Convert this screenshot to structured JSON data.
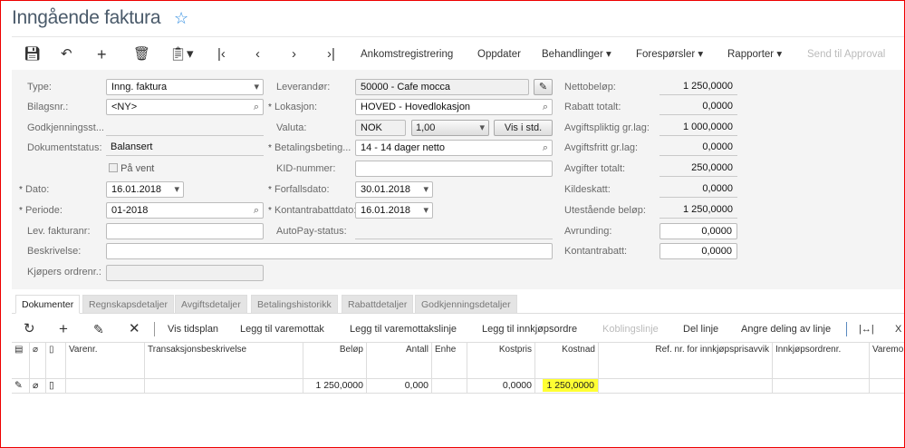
{
  "header": {
    "title": "Inngående faktura"
  },
  "toolbar": {
    "icons": [
      "save-icon",
      "undo-icon",
      "add-icon",
      "delete-icon",
      "clipboard-icon",
      "first-icon",
      "prev-icon",
      "next-icon",
      "last-icon"
    ],
    "ankomst": "Ankomstregistrering",
    "oppdater": "Oppdater",
    "behandlinger": "Behandlinger",
    "foresporsler": "Forespørsler",
    "rapporter": "Rapporter",
    "send": "Send til Approval"
  },
  "form": {
    "type_label": "Type:",
    "type_value": "Inng. faktura",
    "bilag_label": "Bilagsnr.:",
    "bilag_value": "<NY>",
    "godkj_label": "Godkjenningsst...",
    "status_label": "Dokumentstatus:",
    "status_value": "Balansert",
    "pavent_label": "På vent",
    "dato_label": "Dato:",
    "dato_value": "16.01.2018",
    "periode_label": "Periode:",
    "periode_value": "01-2018",
    "levfakt_label": "Lev. fakturanr:",
    "levfakt_value": "",
    "beskr_label": "Beskrivelse:",
    "beskr_value": "",
    "kjopers_label": "Kjøpers ordrenr.:",
    "kjopers_value": "",
    "lev_label": "Leverandør:",
    "lev_value": "50000 - Cafe mocca",
    "lok_label": "Lokasjon:",
    "lok_value": "HOVED - Hovedlokasjon",
    "valuta_label": "Valuta:",
    "valuta_value": "NOK",
    "kurs_value": "1,00",
    "vis_std": "Vis i std.",
    "betal_label": "Betalingsbeting...",
    "betal_value": "14 - 14 dager netto",
    "kid_label": "KID-nummer:",
    "kid_value": "",
    "forfall_label": "Forfallsdato:",
    "forfall_value": "30.01.2018",
    "kontdato_label": "Kontantrabattdato:",
    "kontdato_value": "16.01.2018",
    "autopay_label": "AutoPay-status:",
    "totals": [
      {
        "label": "Nettobeløp:",
        "value": "1 250,0000"
      },
      {
        "label": "Rabatt totalt:",
        "value": "0,0000"
      },
      {
        "label": "Avgiftspliktig gr.lag:",
        "value": "1 000,0000"
      },
      {
        "label": "Avgiftsfritt gr.lag:",
        "value": "0,0000"
      },
      {
        "label": "Avgifter totalt:",
        "value": "250,0000"
      },
      {
        "label": "Kildeskatt:",
        "value": "0,0000"
      },
      {
        "label": "Utestående beløp:",
        "value": "1 250,0000"
      },
      {
        "label": "Avrunding:",
        "value": "0,0000"
      },
      {
        "label": "Kontantrabatt:",
        "value": "0,0000"
      }
    ]
  },
  "tabs": [
    "Dokumenter",
    "Regnskapsdetaljer",
    "Avgiftsdetaljer",
    "Betalingshistorikk",
    "Rabattdetaljer",
    "Godkjenningsdetaljer"
  ],
  "grid_toolbar": {
    "vis_tidsplan": "Vis tidsplan",
    "legg_varemottak": "Legg til varemottak",
    "legg_varemottakslinje": "Legg til varemottakslinje",
    "legg_innkjop": "Legg til innkjøpsordre",
    "kobling": "Koblingslinje",
    "del": "Del linje",
    "angre": "Angre deling av linje"
  },
  "grid": {
    "columns": [
      "Varenr.",
      "Transaksjonsbeskrivelse",
      "Beløp",
      "Antall",
      "Enhe",
      "Kostpris",
      "Kostnad",
      "Ref. nr. for innkjøpsprisavvik",
      "Innkjøpsordrenr.",
      "Varemo"
    ],
    "rows": [
      {
        "varenr": "",
        "beskr": "",
        "belop": "1 250,0000",
        "antall": "0,000",
        "enhet": "",
        "kostpris": "0,0000",
        "kostnad": "1 250,0000",
        "ref": "",
        "innkjop": "",
        "varemo": ""
      }
    ]
  },
  "colors": {
    "highlight": "#ffff33",
    "accent": "#2a8ae0",
    "border": "#ff0000"
  }
}
